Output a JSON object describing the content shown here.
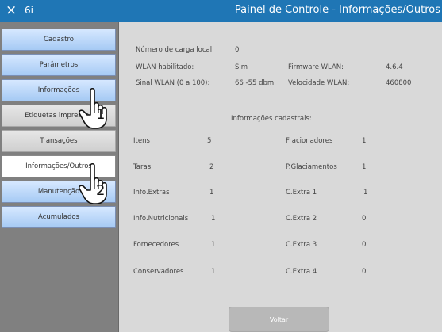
{
  "titlebar": {
    "close_glyph": "×",
    "app_name": "6i",
    "title": "Painel de Controle - Informações/Outros"
  },
  "sidebar": {
    "items": [
      {
        "label": "Cadastro",
        "style": "blue"
      },
      {
        "label": "Parâmetros",
        "style": "blue"
      },
      {
        "label": "Informações",
        "style": "blue"
      },
      {
        "label": "Etiquetas impressas",
        "style": "gray"
      },
      {
        "label": "Transações",
        "style": "gray"
      },
      {
        "label": "Informações/Outros",
        "style": "white"
      },
      {
        "label": "Manutenção",
        "style": "blue"
      },
      {
        "label": "Acumulados",
        "style": "blue"
      }
    ]
  },
  "info": {
    "load_number_label": "Número de carga local",
    "load_number_value": "0",
    "wlan_enabled_label": "WLAN habilitado:",
    "wlan_enabled_value": "Sim",
    "firmware_label": "Firmware WLAN:",
    "firmware_value": "4.6.4",
    "signal_label": "Sinal WLAN (0 a 100):",
    "signal_value": "66  -55 dbm",
    "speed_label": "Velocidade WLAN:",
    "speed_value": "460800"
  },
  "registry": {
    "heading": "Informações cadastrais:",
    "left": [
      {
        "label": "Itens",
        "value": "5"
      },
      {
        "label": "Taras",
        "value": "2"
      },
      {
        "label": "Info.Extras",
        "value": "1"
      },
      {
        "label": "Info.Nutricionais",
        "value": "1"
      },
      {
        "label": "Fornecedores",
        "value": "1"
      },
      {
        "label": "Conservadores",
        "value": "1"
      }
    ],
    "right": [
      {
        "label": "Fracionadores",
        "value": "1"
      },
      {
        "label": "P.Glaciamentos",
        "value": "1"
      },
      {
        "label": "C.Extra 1",
        "value": "1"
      },
      {
        "label": "C.Extra 2",
        "value": "0"
      },
      {
        "label": "C.Extra 3",
        "value": "0"
      },
      {
        "label": "C.Extra 4",
        "value": "0"
      }
    ]
  },
  "footer": {
    "back_label": "Voltar"
  },
  "annotations": {
    "step1": "1",
    "step2": "2"
  },
  "colors": {
    "titlebar": "#1f76b5",
    "sidebar_bg": "#808080",
    "content_bg": "#d9d9d9",
    "button_blue_top": "#d6e8ff",
    "button_blue_bottom": "#a6caf4"
  }
}
